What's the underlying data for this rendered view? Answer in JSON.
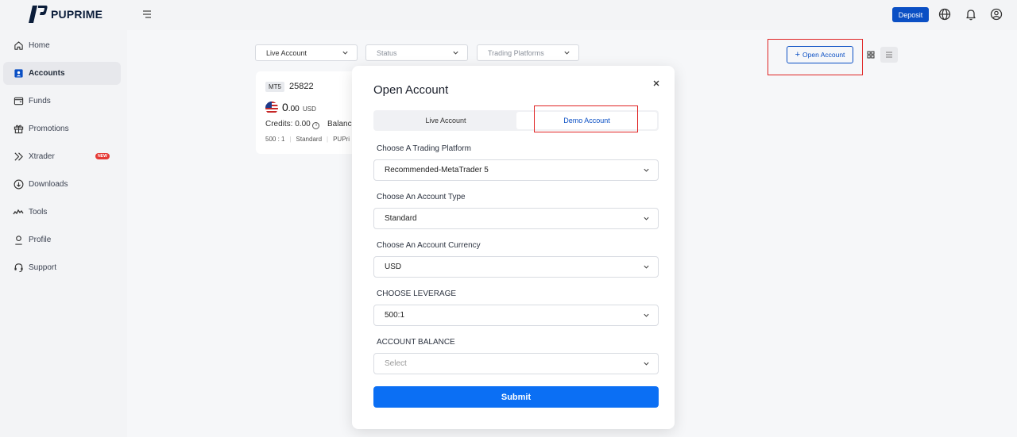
{
  "brand": {
    "name": "PUPRIME"
  },
  "header": {
    "deposit_label": "Deposit",
    "icons": [
      "menu-toggle-icon",
      "globe-icon",
      "bell-icon",
      "user-icon"
    ]
  },
  "sidebar": {
    "items": [
      {
        "label": "Home",
        "icon": "home-icon"
      },
      {
        "label": "Accounts",
        "icon": "accounts-icon",
        "active": true
      },
      {
        "label": "Funds",
        "icon": "wallet-icon"
      },
      {
        "label": "Promotions",
        "icon": "gift-icon"
      },
      {
        "label": "Xtrader",
        "icon": "xtrader-icon",
        "badge": "NEW"
      },
      {
        "label": "Downloads",
        "icon": "download-icon"
      },
      {
        "label": "Tools",
        "icon": "tools-icon"
      },
      {
        "label": "Profile",
        "icon": "profile-icon"
      },
      {
        "label": "Support",
        "icon": "headset-icon"
      }
    ]
  },
  "filters": {
    "account_type": "Live Account",
    "status": "Status",
    "platforms": "Trading Platforms"
  },
  "open_account_label": "Open Account",
  "account_card": {
    "platform": "MT5",
    "number": "25822",
    "balance_int": "0",
    "balance_dec": ".00",
    "currency": "USD",
    "credits": "Credits: 0.00",
    "balance_label": "Balance",
    "leverage": "500 : 1",
    "type": "Standard",
    "server": "PUPri"
  },
  "modal": {
    "title": "Open Account",
    "tabs": {
      "live": "Live Account",
      "demo": "Demo Account"
    },
    "fields": {
      "platform_label": "Choose A Trading Platform",
      "platform_value": "Recommended-MetaTrader 5",
      "type_label": "Choose An Account Type",
      "type_value": "Standard",
      "currency_label": "Choose An Account Currency",
      "currency_value": "USD",
      "leverage_label": "CHOOSE LEVERAGE",
      "leverage_value": "500:1",
      "balance_label": "ACCOUNT BALANCE",
      "balance_placeholder": "Select"
    },
    "submit_label": "Submit"
  },
  "colors": {
    "accent": "#0a4fc4",
    "submit": "#0b6ff4",
    "highlight": "#e02424"
  }
}
